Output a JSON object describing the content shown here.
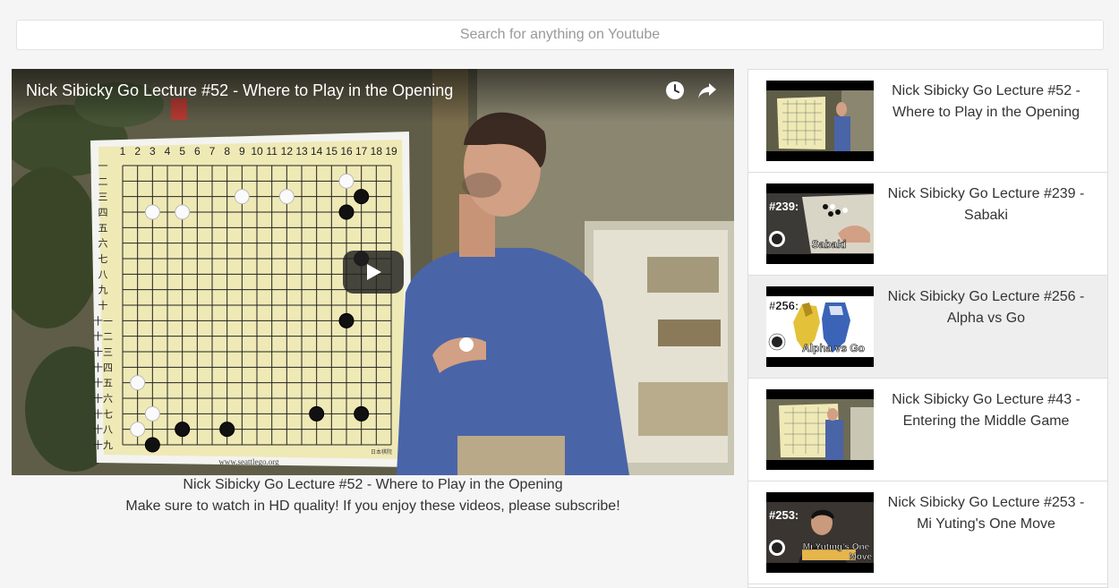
{
  "search": {
    "placeholder": "Search for anything on Youtube",
    "value": ""
  },
  "player": {
    "title": "Nick Sibicky Go Lecture #52 - Where to Play in the Opening",
    "icons": [
      "watch-later-icon",
      "share-icon",
      "play-icon"
    ],
    "board": {
      "col_labels": [
        "1",
        "2",
        "3",
        "4",
        "5",
        "6",
        "7",
        "8",
        "9",
        "10",
        "11",
        "12",
        "13",
        "14",
        "15",
        "16",
        "17",
        "18",
        "19"
      ],
      "row_labels": [
        "一",
        "二",
        "三",
        "四",
        "五",
        "六",
        "七",
        "八",
        "九",
        "十",
        "十一",
        "十二",
        "十三",
        "十四",
        "十五",
        "十六",
        "十七",
        "十八",
        "十九"
      ],
      "footer_text": "www.seattlego.org",
      "maker_mark": "日本棋院"
    }
  },
  "video_info": {
    "title": "Nick Sibicky Go Lecture #52 - Where to Play in the Opening",
    "description": "Make sure to watch in HD quality! If you enjoy these videos, please subscribe!"
  },
  "playlist": {
    "items": [
      {
        "label": "Nick Sibicky Go Lecture #52 - Where to Play in the Opening",
        "thumb_text": "",
        "active": false
      },
      {
        "label": "Nick Sibicky Go Lecture #239 - Sabaki",
        "thumb_text": "#239:",
        "thumb_caption": "Sabaki",
        "active": false
      },
      {
        "label": "Nick Sibicky Go Lecture #256 - Alpha vs Go",
        "thumb_text": "#256:",
        "thumb_caption": "Alpha vs Go",
        "active": true
      },
      {
        "label": "Nick Sibicky Go Lecture #43 - Entering the Middle Game",
        "thumb_text": "",
        "active": false
      },
      {
        "label": "Nick Sibicky Go Lecture #253 - Mi Yuting's One Move",
        "thumb_text": "#253:",
        "thumb_caption": "Mi Yuting's One Move",
        "active": false
      }
    ]
  },
  "colors": {
    "page_bg": "#f5f5f5",
    "board": "#efe9b6",
    "shirt": "#4a64a8",
    "active_item": "#eeeeee",
    "border": "#dddddd"
  }
}
